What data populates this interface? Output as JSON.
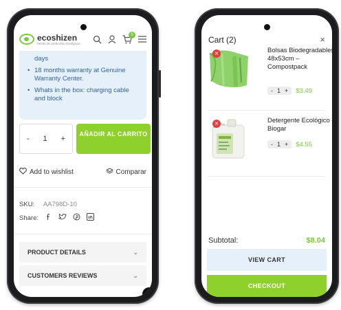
{
  "left_screen": {
    "logo": {
      "name": "ecoshizen",
      "tagline": "tienda de productos ecológicos"
    },
    "header_icons": [
      "search-icon",
      "user-icon",
      "cart-icon",
      "menu-icon"
    ],
    "cart_badge": "0",
    "info": {
      "days_text": "days",
      "bullets": [
        "18 months warranty at Genuine Warranty Center.",
        "Whats in the box: charging cable and block"
      ]
    },
    "quantity": {
      "minus": "-",
      "value": "1",
      "plus": "+"
    },
    "add_to_cart_label": "AÑADIR AL CARRITO",
    "wishlist_label": "Add to wishlist",
    "compare_label": "Comparar",
    "sku_label": "SKU:",
    "sku_value": "AA798D-10",
    "share_label": "Share:",
    "share_icons": [
      "facebook-icon",
      "twitter-icon",
      "pinterest-icon",
      "linkedin-icon"
    ],
    "accordion": [
      "PRODUCT DETAILS",
      "CUSTOMERS REVIEWS"
    ],
    "scroll_top": "↑"
  },
  "right_screen": {
    "title": "Cart (2)",
    "close": "×",
    "items": [
      {
        "name": "Bolsas Biodegradables 48x53cm – Compostpack",
        "qty": "1",
        "price": "$3.49"
      },
      {
        "name": "Detergente Ecológico – Biogar",
        "qty": "1",
        "price": "$4.55"
      }
    ],
    "subtotal_label": "Subtotal:",
    "subtotal_value": "$8.04",
    "view_cart_label": "VIEW CART",
    "checkout_label": "CHECKOUT"
  },
  "colors": {
    "accent_green": "#8fd12c",
    "price_green": "#7ac943",
    "info_blue": "#2f64a5",
    "info_bg": "#e5f0fb",
    "remove_red": "#e0403f"
  }
}
